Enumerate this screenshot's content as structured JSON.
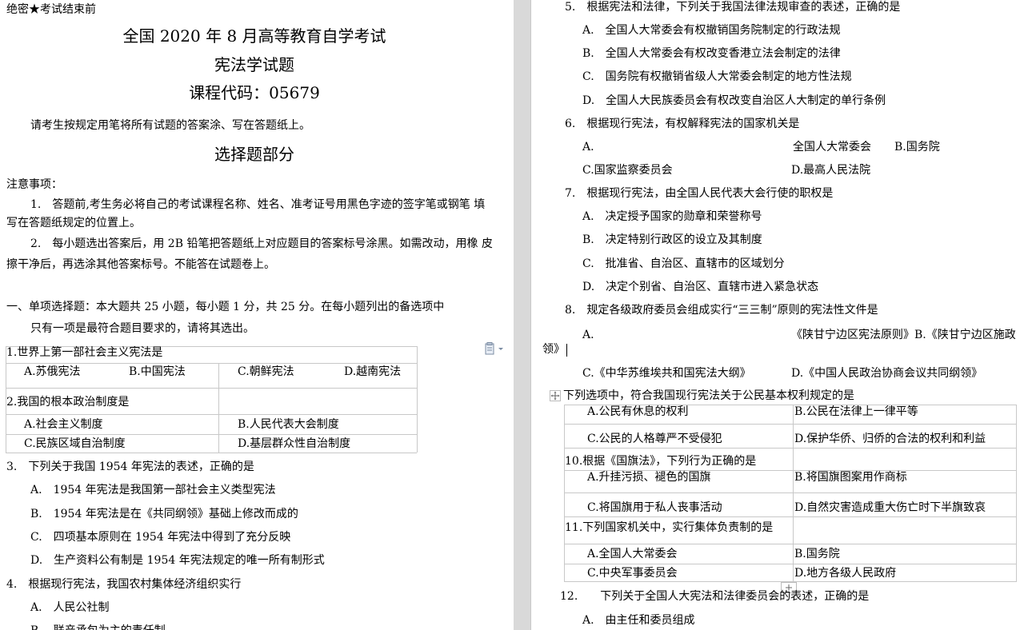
{
  "left": {
    "secret_tag": "绝密★考试结束前",
    "title_line": "全国 2020 年 8 月高等教育自学考试",
    "subject": "宪法学试题",
    "course_code": "课程代码：05679",
    "instruction": "请考生按规定用笔将所有试题的答案涂、写在答题纸上。",
    "section_title": "选择题部分",
    "notes_heading": "注意事项：",
    "note1_line1": "1.　答题前,考生务必将自己的考试课程名称、姓名、准考证号用黑色字迹的签字笔或钢笔 填",
    "note1_line2": "写在答题纸规定的位置上。",
    "note2_line1": "2.　每小题选出答案后，用 2B 铅笔把答题纸上对应题目的答案标号涂黑。如需改动，用橡 皮",
    "note2_line2": "擦干净后，再选涂其他答案标号。不能答在试题卷上。",
    "part1_line1": "一、单项选择题：本大题共 25 小题，每小题 1 分，共 25 分。在每小题列出的备选项中",
    "part1_line2": "只有一项是最符合题目要求的，请将其选出。",
    "q1": {
      "stem": "1.世界上第一部社会主义宪法是",
      "a": "A.苏俄宪法",
      "b": "B.中国宪法",
      "c": "C.朝鲜宪法",
      "d": "D.越南宪法"
    },
    "q2": {
      "stem": "2.我国的根本政治制度是",
      "a": "A.社会主义制度",
      "b": "B.人民代表大会制度",
      "c": "C.民族区域自治制度",
      "d": "D.基层群众性自治制度"
    },
    "q3": {
      "stem": "3.　下列关于我国 1954 年宪法的表述，正确的是",
      "a": "A.　1954 年宪法是我国第一部社会主义类型宪法",
      "b": "B.　1954 年宪法是在《共同纲领》基础上修改而成的",
      "c": "C.　四项基本原则在 1954 年宪法中得到了充分反映",
      "d": "D.　生产资料公有制是 1954 年宪法规定的唯一所有制形式"
    },
    "q4": {
      "stem": "4.　根据现行宪法，我国农村集体经济组织实行",
      "a": "A.　人民公社制",
      "b": "B.　联产承包为主的责任制"
    }
  },
  "right": {
    "q5": {
      "stem": "5.　根据宪法和法律，下列关于我国法律法规审查的表述，正确的是",
      "a": "A.　全国人大常委会有权撤销国务院制定的行政法规",
      "b": "B.　全国人大常委会有权改变香港立法会制定的法律",
      "c": "C.　国务院有权撤销省级人大常委会制定的地方性法规",
      "d": "D.　全国人大民族委员会有权改变自治区人大制定的单行条例"
    },
    "q6": {
      "stem": "6.　根据现行宪法，有权解释宪法的国家机关是",
      "a_letter": "A.",
      "a": "全国人大常委会",
      "b": "B.国务院",
      "c": "C.国家监察委员会",
      "d": "D.最高人民法院"
    },
    "q7": {
      "stem": "7.　根据现行宪法，由全国人民代表大会行使的职权是",
      "a": "A.　决定授予国家的勋章和荣誉称号",
      "b": "B.　决定特别行政区的设立及其制度",
      "c": "C.　批准省、自治区、直辖市的区域划分",
      "d": "D.　决定个别省、自治区、直辖市进入紧急状态"
    },
    "q8": {
      "stem": "8.　规定各级政府委员会组成实行“三三制”原则的宪法性文件是",
      "a_letter": "A.",
      "a": "《陕甘宁边区宪法原则》B.《陕甘宁边区施政",
      "a_wrap": "领》",
      "c": "C.《中华苏维埃共和国宪法大纲》",
      "d": "D.《中国人民政治协商会议共同纲领》"
    },
    "q9": {
      "stem": "下列选项中，符合我国现行宪法关于公民基本权利规定的是",
      "a": "A.公民有休息的权利",
      "b": "B.公民在法律上一律平等",
      "c": "C.公民的人格尊严不受侵犯",
      "d": "D.保护华侨、归侨的合法的权利和利益"
    },
    "q10": {
      "stem": "10.根据《国旗法》，下列行为正确的是",
      "a": "A.升挂污损、褪色的国旗",
      "b": "B.将国旗图案用作商标",
      "c": "C.将国旗用于私人丧事活动",
      "d": "D.自然灾害造成重大伤亡时下半旗致哀"
    },
    "q11": {
      "stem": "11.下列国家机关中，实行集体负责制的是",
      "a": "A.全国人大常委会",
      "b": "B.国务院",
      "c": "C.中央军事委员会",
      "d": "D.地方各级人民政府"
    },
    "q12": {
      "stem": "12.　　下列关于全国人大宪法和法律委员会的表述，正确的是",
      "a": "A.　由主任和委员组成"
    }
  },
  "icons": {
    "paste_options": "paste-options-icon",
    "table_move": "table-move-handle-icon",
    "add_row": "add-row-icon"
  }
}
